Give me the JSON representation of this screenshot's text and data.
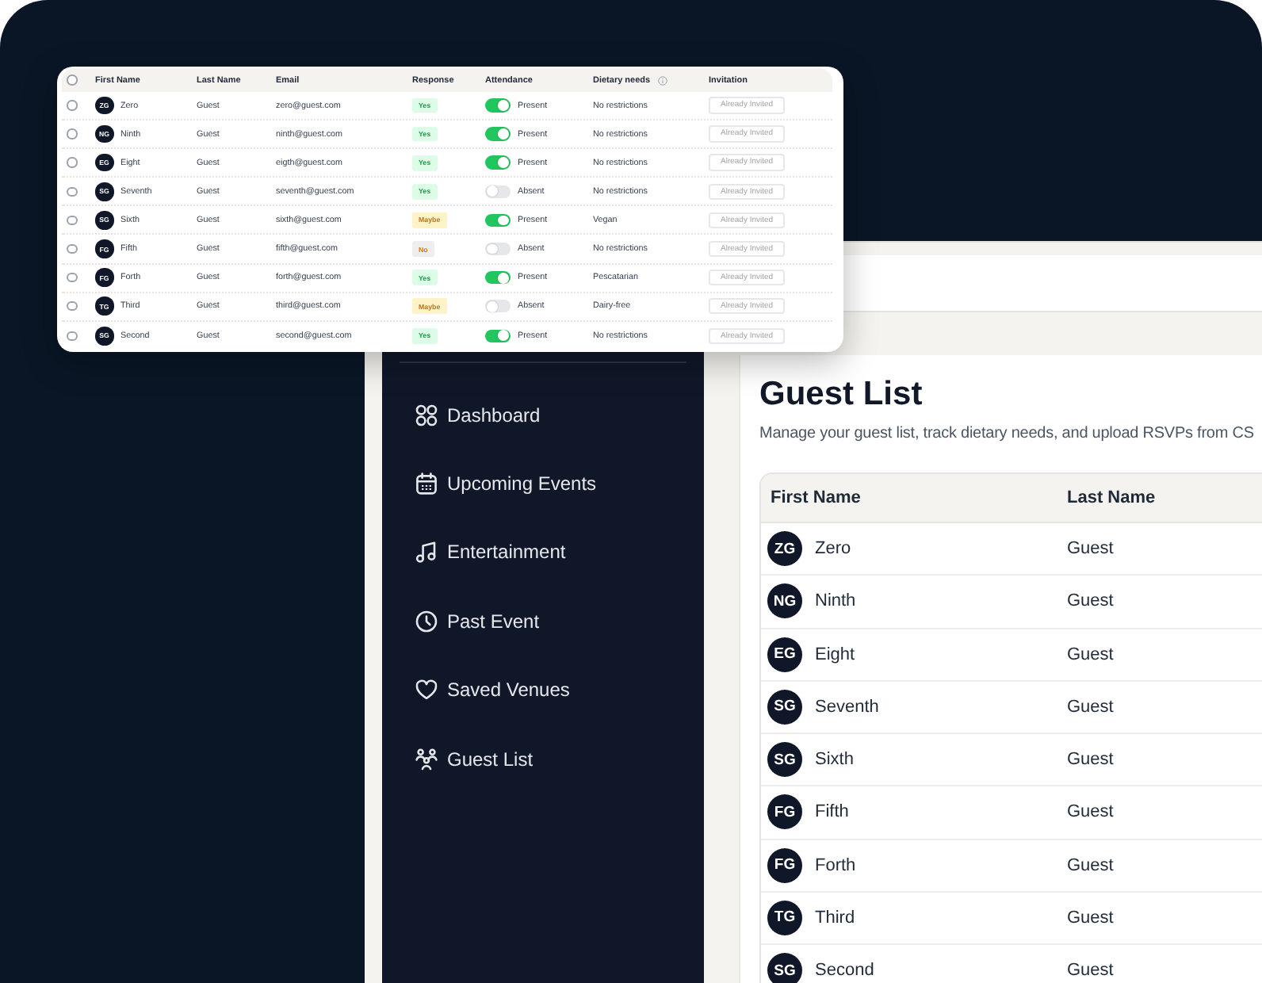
{
  "guest_table_card": {
    "select_all_checked": false,
    "columns": [
      {
        "label": "First Name",
        "info": false
      },
      {
        "label": "Last Name",
        "info": false
      },
      {
        "label": "Email",
        "info": false
      },
      {
        "label": "Response",
        "info": false
      },
      {
        "label": "Attendance",
        "info": false
      },
      {
        "label": "Dietary needs",
        "info": true
      },
      {
        "label": "Invitation",
        "info": false
      }
    ],
    "rows": [
      {
        "checked": false,
        "initials": "ZG",
        "first_name": "Zero",
        "last_name": "Guest",
        "email": "zero@guest.com",
        "response": {
          "label": "Yes",
          "kind": "yes"
        },
        "attending": true,
        "attendance": "Present",
        "dietary": "No restrictions",
        "invitation": "Already Invited",
        "invitation_disabled": true
      },
      {
        "checked": false,
        "initials": "NG",
        "first_name": "Ninth",
        "last_name": "Guest",
        "email": "ninth@guest.com",
        "response": {
          "label": "Yes",
          "kind": "yes"
        },
        "attending": true,
        "attendance": "Present",
        "dietary": "No restrictions",
        "invitation": "Already Invited",
        "invitation_disabled": true
      },
      {
        "checked": false,
        "initials": "EG",
        "first_name": "Eight",
        "last_name": "Guest",
        "email": "eigth@guest.com",
        "response": {
          "label": "Yes",
          "kind": "yes"
        },
        "attending": true,
        "attendance": "Present",
        "dietary": "No restrictions",
        "invitation": "Already Invited",
        "invitation_disabled": true
      },
      {
        "checked": false,
        "initials": "SG",
        "first_name": "Seventh",
        "last_name": "Guest",
        "email": "seventh@guest.com",
        "response": {
          "label": "Yes",
          "kind": "yes"
        },
        "attending": false,
        "attendance": "Absent",
        "dietary": "No restrictions",
        "invitation": "Already Invited",
        "invitation_disabled": true
      },
      {
        "checked": false,
        "initials": "SG",
        "first_name": "Sixth",
        "last_name": "Guest",
        "email": "sixth@guest.com",
        "response": {
          "label": "Maybe",
          "kind": "maybe"
        },
        "attending": true,
        "attendance": "Present",
        "dietary": "Vegan",
        "invitation": "Already Invited",
        "invitation_disabled": true
      },
      {
        "checked": false,
        "initials": "FG",
        "first_name": "Fifth",
        "last_name": "Guest",
        "email": "fifth@guest.com",
        "response": {
          "label": "No",
          "kind": "no"
        },
        "attending": false,
        "attendance": "Absent",
        "dietary": "No restrictions",
        "invitation": "Already Invited",
        "invitation_disabled": true
      },
      {
        "checked": false,
        "initials": "FG",
        "first_name": "Forth",
        "last_name": "Guest",
        "email": "forth@guest.com",
        "response": {
          "label": "Yes",
          "kind": "yes"
        },
        "attending": true,
        "attendance": "Present",
        "dietary": "Pescatarian",
        "invitation": "Already Invited",
        "invitation_disabled": true
      },
      {
        "checked": false,
        "initials": "TG",
        "first_name": "Third",
        "last_name": "Guest",
        "email": "third@guest.com",
        "response": {
          "label": "Maybe",
          "kind": "maybe"
        },
        "attending": false,
        "attendance": "Absent",
        "dietary": "Dairy-free",
        "invitation": "Already Invited",
        "invitation_disabled": true
      },
      {
        "checked": false,
        "initials": "SG",
        "first_name": "Second",
        "last_name": "Guest",
        "email": "second@guest.com",
        "response": {
          "label": "Yes",
          "kind": "yes"
        },
        "attending": true,
        "attendance": "Present",
        "dietary": "No restrictions",
        "invitation": "Already Invited",
        "invitation_disabled": true
      }
    ]
  },
  "app_window": {
    "sidebar": {
      "items": [
        {
          "label": "Dashboard",
          "selected": false
        },
        {
          "label": "Upcoming Events",
          "selected": false
        },
        {
          "label": "Entertainment",
          "selected": false
        },
        {
          "label": "Past Event",
          "selected": false
        },
        {
          "label": "Saved Venues",
          "selected": false
        },
        {
          "label": "Guest List",
          "selected": false
        }
      ]
    },
    "content": {
      "title": "Guest List",
      "description": "Manage your guest list, track dietary needs, and upload RSVPs from CS",
      "table": {
        "columns": [
          "First Name",
          "Last Name"
        ],
        "rows": [
          {
            "initials": "ZG",
            "first_name": "Zero",
            "last_name": "Guest"
          },
          {
            "initials": "NG",
            "first_name": "Ninth",
            "last_name": "Guest"
          },
          {
            "initials": "EG",
            "first_name": "Eight",
            "last_name": "Guest"
          },
          {
            "initials": "SG",
            "first_name": "Seventh",
            "last_name": "Guest"
          },
          {
            "initials": "SG",
            "first_name": "Sixth",
            "last_name": "Guest"
          },
          {
            "initials": "FG",
            "first_name": "Fifth",
            "last_name": "Guest"
          },
          {
            "initials": "FG",
            "first_name": "Forth",
            "last_name": "Guest"
          },
          {
            "initials": "TG",
            "first_name": "Third",
            "last_name": "Guest"
          },
          {
            "initials": "SG",
            "first_name": "Second",
            "last_name": "Guest"
          }
        ]
      }
    }
  }
}
